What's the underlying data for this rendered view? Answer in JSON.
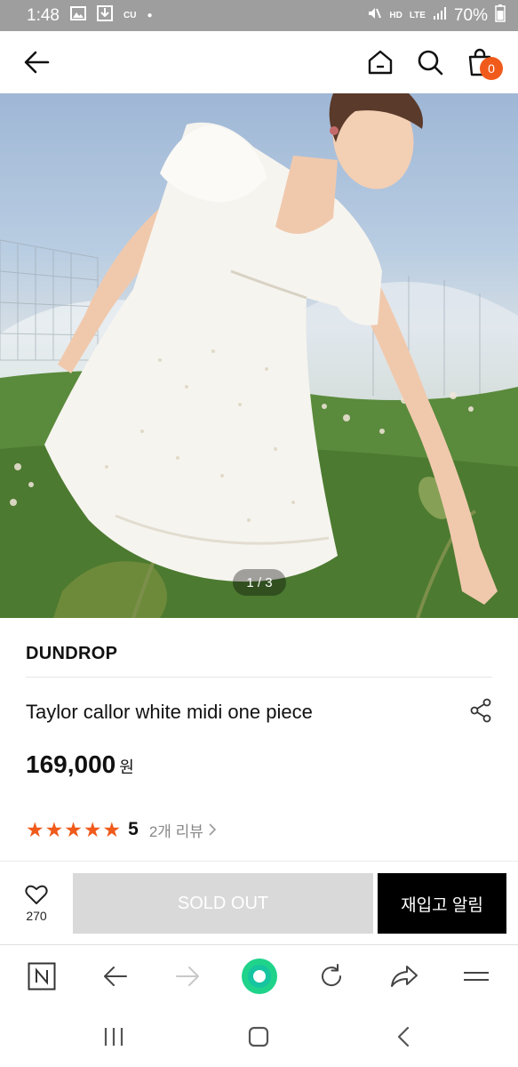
{
  "status_bar": {
    "time": "1:48",
    "carrier": "CU",
    "hd_label": "HD",
    "lte_label": "LTE",
    "battery": "70%"
  },
  "header": {
    "cart_count": "0"
  },
  "gallery": {
    "counter": "1 / 3"
  },
  "product": {
    "brand": "DUNDROP",
    "name": "Taylor callor white midi one piece",
    "price": "169,000",
    "currency": "원",
    "rating": "5",
    "review_count": "2개 리뷰",
    "star_color": "#f05a1a"
  },
  "actions": {
    "wishlist_count": "270",
    "sold_out_label": "SOLD OUT",
    "restock_label": "재입고 알림"
  },
  "browser_toolbar": {
    "items": [
      "n-icon",
      "back-arrow-icon",
      "forward-arrow-icon",
      "home-dot-icon",
      "refresh-icon",
      "share-arrow-icon",
      "menu-icon"
    ]
  },
  "colors": {
    "accent": "#f05a1a",
    "status_bar": "#9e9e9e",
    "sold_out_bg": "#d9d9d9",
    "browser_home": "#1fd38a"
  }
}
